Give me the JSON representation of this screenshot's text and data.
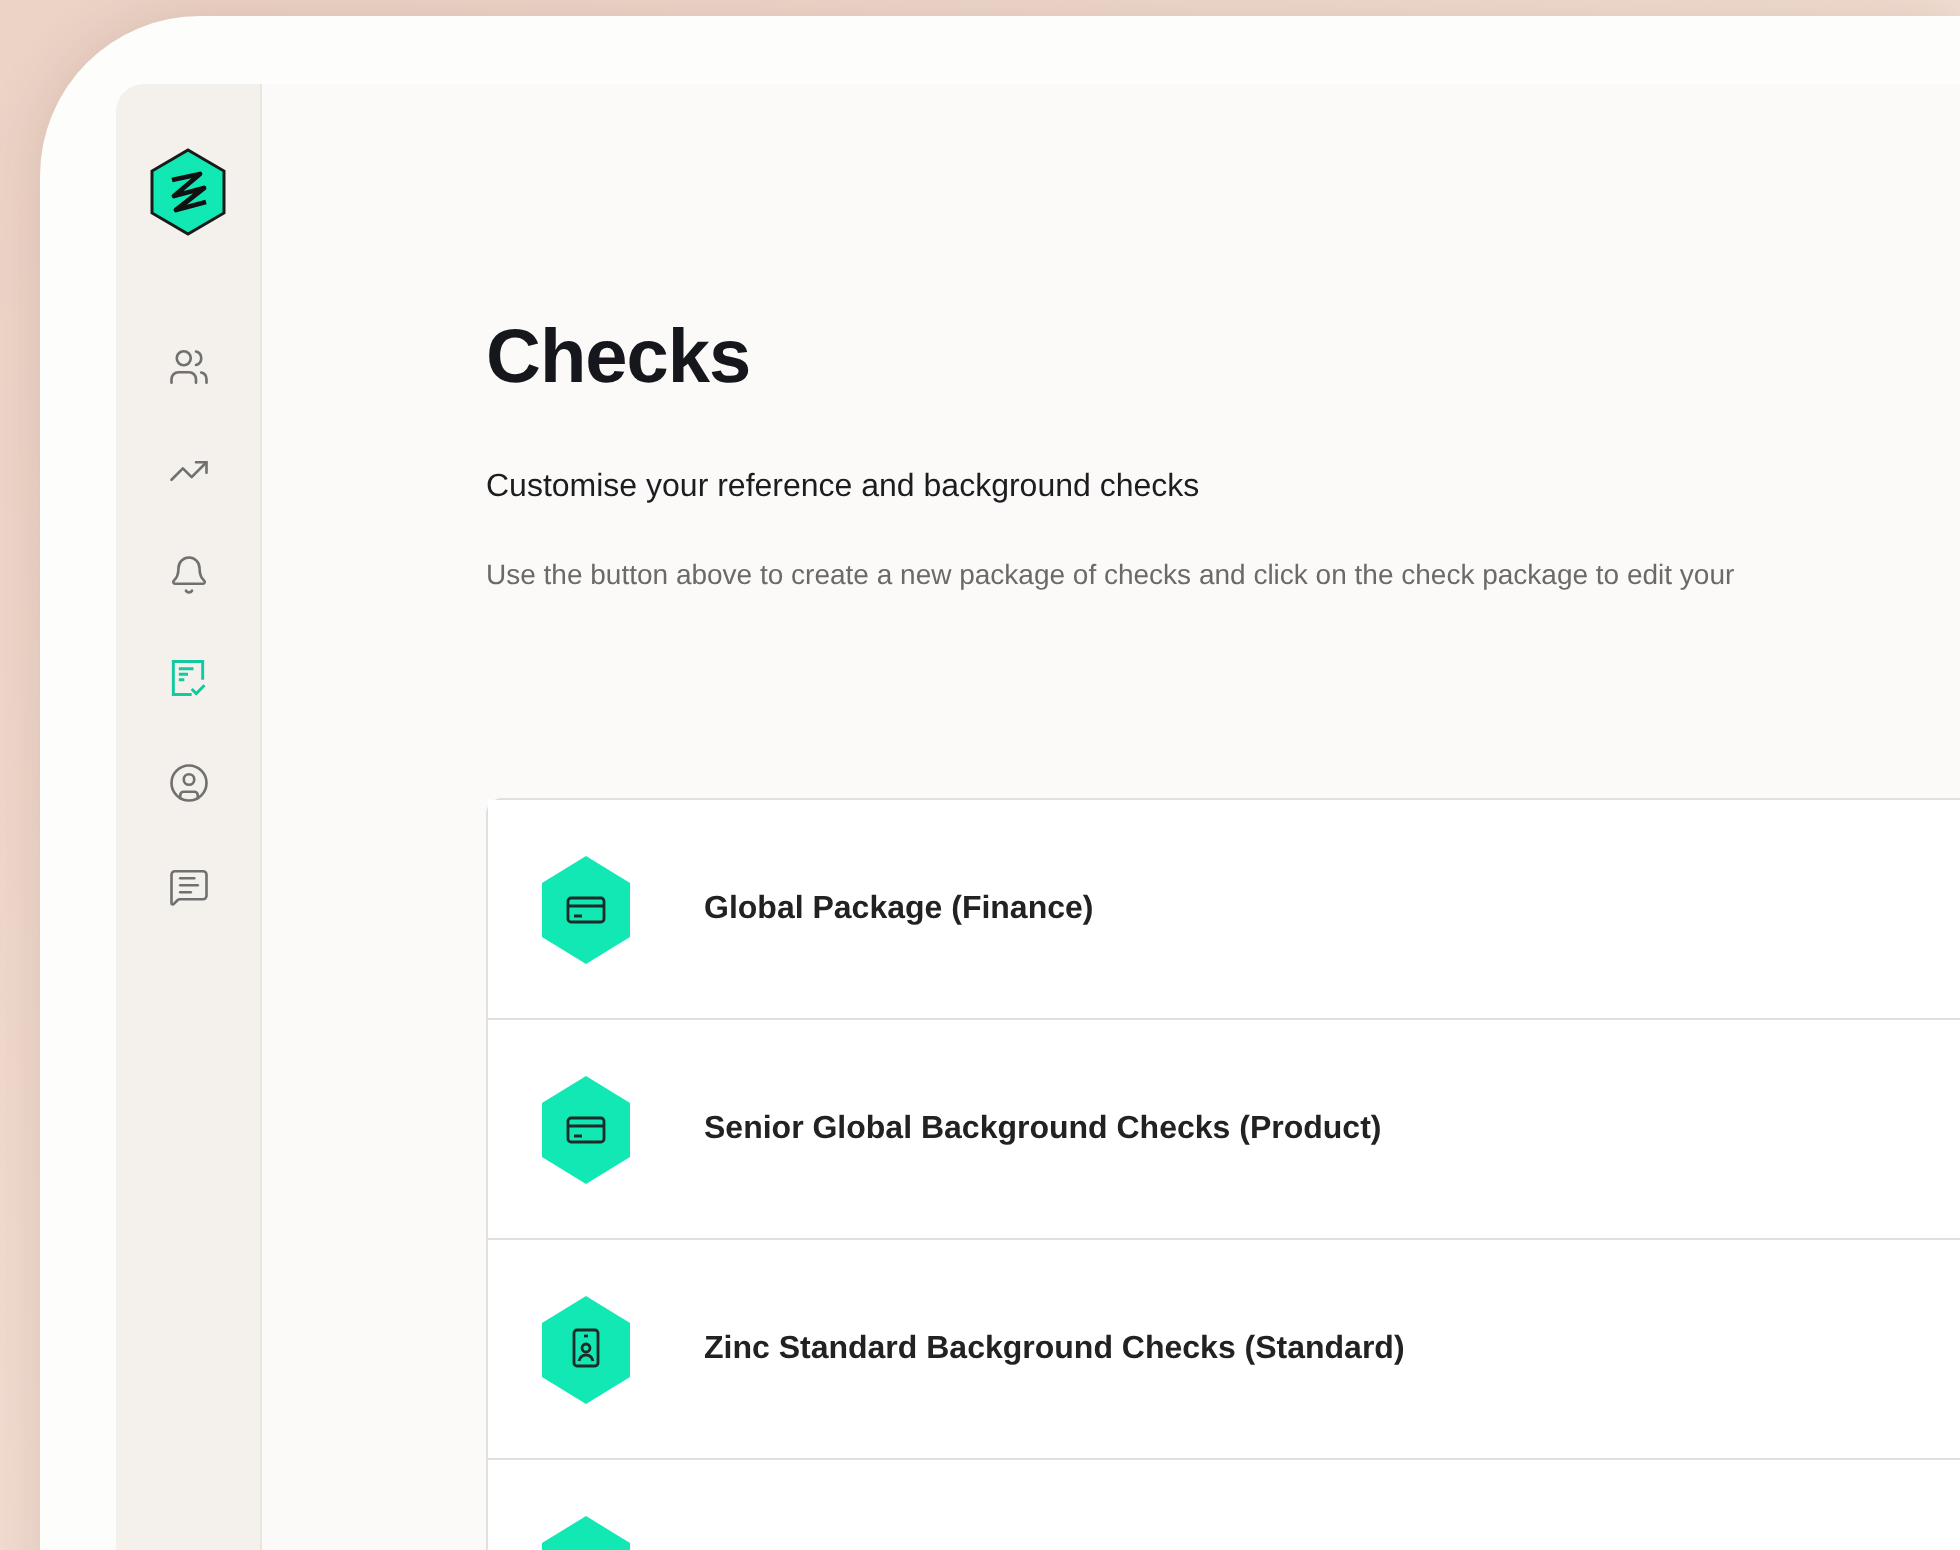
{
  "sidebar": {
    "items": [
      {
        "kind": "people",
        "selected": false
      },
      {
        "kind": "trend",
        "selected": false
      },
      {
        "kind": "bell",
        "selected": false
      },
      {
        "kind": "checklist",
        "selected": true
      },
      {
        "kind": "profile",
        "selected": false
      },
      {
        "kind": "message",
        "selected": false
      }
    ]
  },
  "page": {
    "title": "Checks",
    "subtitle": "Customise your reference and background checks",
    "description": "Use the button above to create a new package of checks and click on the check package to edit your"
  },
  "packages": [
    {
      "kind": "card",
      "title": "Global Package (Finance)"
    },
    {
      "kind": "card",
      "title": "Senior Global Background Checks (Product)"
    },
    {
      "kind": "badge",
      "title": "Zinc Standard Background Checks (Standard)"
    },
    {
      "kind": "blank"
    }
  ]
}
